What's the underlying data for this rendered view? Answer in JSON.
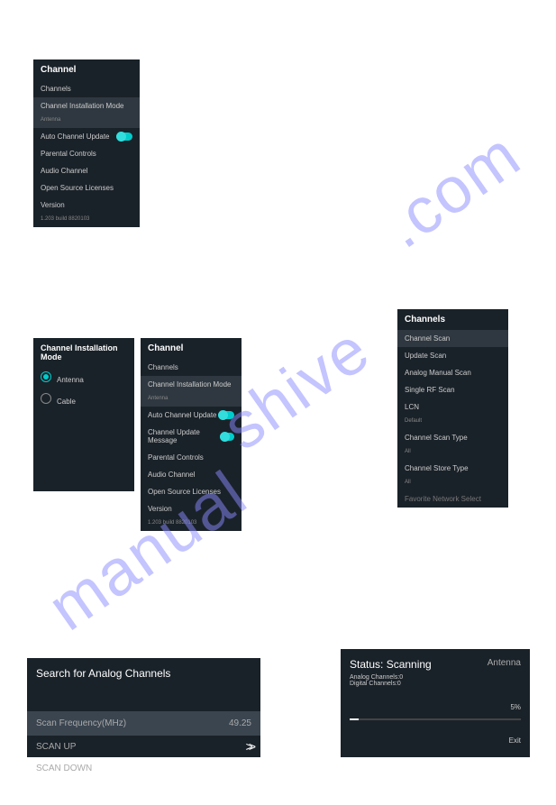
{
  "watermark": "manualshive.com",
  "p1": {
    "title": "Channel",
    "channels": "Channels",
    "mode": "Channel Installation Mode",
    "mode_val": "Antenna",
    "auto": "Auto Channel Update",
    "parental": "Parental Controls",
    "audio": "Audio Channel",
    "oss": "Open Source Licenses",
    "ver": "Version",
    "ver_val": "1.203 build 8820103"
  },
  "p2": {
    "title": "Channel Installation Mode",
    "antenna": "Antenna",
    "cable": "Cable"
  },
  "p3": {
    "title": "Channel",
    "channels": "Channels",
    "mode": "Channel Installation Mode",
    "mode_val": "Antenna",
    "auto": "Auto Channel Update",
    "msg": "Channel Update Message",
    "parental": "Parental Controls",
    "audio": "Audio Channel",
    "oss": "Open Source Licenses",
    "ver": "Version",
    "ver_val": "1.203 build 8820103"
  },
  "p4": {
    "title": "Channels",
    "scan": "Channel Scan",
    "update": "Update Scan",
    "analog": "Analog Manual Scan",
    "single": "Single RF Scan",
    "lcn": "LCN",
    "lcn_val": "Default",
    "scan_type": "Channel Scan Type",
    "scan_type_val": "All",
    "store_type": "Channel Store Type",
    "store_type_val": "All",
    "network": "Favorite Network Select"
  },
  "p5": {
    "title": "Search for Analog Channels",
    "freq": "Scan Frequency(MHz)",
    "freq_val": "49.25",
    "up": "SCAN UP",
    "down": "SCAN DOWN"
  },
  "p6": {
    "title": "Status: Scanning",
    "ant": "Antenna",
    "ac": "Analog Channels:0",
    "dc": "Digital Channels:0",
    "pct": "5%",
    "exit": "Exit"
  }
}
